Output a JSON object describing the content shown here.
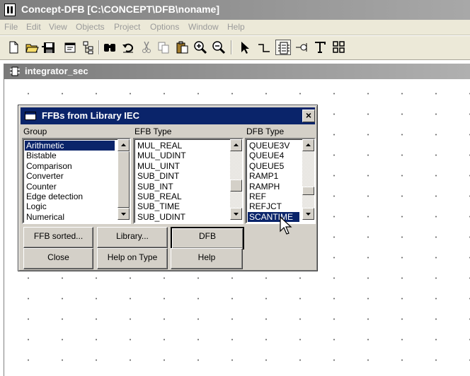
{
  "window": {
    "title": "Concept-DFB [C:\\CONCEPT\\DFB\\noname]"
  },
  "menu": [
    "File",
    "Edit",
    "View",
    "Objects",
    "Project",
    "Options",
    "Window",
    "Help"
  ],
  "toolbar": {
    "icons": [
      "new-file-icon",
      "open-folder-icon",
      "save-icon",
      "properties-icon",
      "structure-icon",
      "binoculars-icon",
      "undo-icon",
      "cut-icon",
      "copy-icon",
      "paste-icon",
      "zoom-in-icon",
      "zoom-out-icon",
      "select-arrow-icon",
      "link-icon",
      "ffb-block-icon",
      "variable-icon",
      "text-icon",
      "grid-icon"
    ]
  },
  "document": {
    "title": "integrator_sec"
  },
  "dialog": {
    "title": "FFBs from Library IEC",
    "group": {
      "label": "Group",
      "items": [
        "Arithmetic",
        "Bistable",
        "Comparison",
        "Converter",
        "Counter",
        "Edge detection",
        "Logic",
        "Numerical"
      ],
      "selected": 0
    },
    "efb": {
      "label": "EFB Type",
      "items": [
        "MUL_REAL",
        "MUL_UDINT",
        "MUL_UINT",
        "SUB_DINT",
        "SUB_INT",
        "SUB_REAL",
        "SUB_TIME",
        "SUB_UDINT"
      ],
      "selected": -1
    },
    "dfb": {
      "label": "DFB Type",
      "items": [
        "QUEUE3V",
        "QUEUE4",
        "QUEUE5",
        "RAMP1",
        "RAMPH",
        "REF",
        "REFJCT",
        "SCANTIME"
      ],
      "selected": 7
    },
    "buttons": {
      "ffb_sorted": "FFB sorted...",
      "library": "Library...",
      "dfb": "DFB",
      "close": "Close",
      "help_on_type": "Help on Type",
      "help": "Help"
    },
    "close_glyph": "×"
  }
}
